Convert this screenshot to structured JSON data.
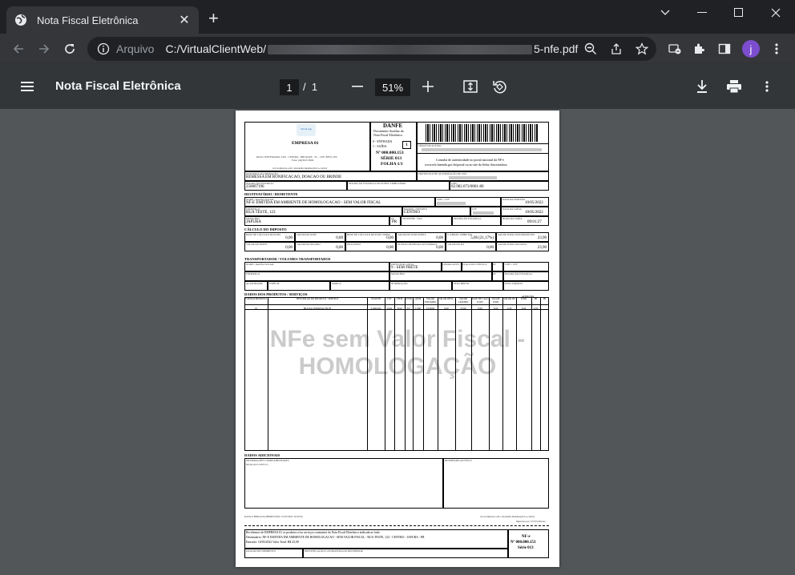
{
  "browser": {
    "tab_title": "Nota Fiscal Eletrônica",
    "tab_close": "✕",
    "new_tab": "+",
    "scheme_label": "Arquivo",
    "url_prefix": "C:/VirtualClientWeb/",
    "url_suffix": "5-nfe.pdf",
    "avatar_letter": "j"
  },
  "pdf_toolbar": {
    "title": "Nota Fiscal Eletrônica",
    "page_current": "1",
    "page_separator": "/",
    "page_total": "1",
    "zoom": "51%"
  },
  "danfe": {
    "company": "EMPRESA 01",
    "address": "RUIO CENTENARIO, 2345 - CENTRO - BRUSQUE - SC - CEP: 88351-500",
    "phone": "Fone: (44)3615-3966",
    "email": "www.empresa.com | alexandre.mendes@tef-o.com.br",
    "danfe_title": "DANFE",
    "danfe_sub1": "Documento Auxiliar da",
    "danfe_sub2": "Nota Fiscal Eletrônica",
    "entrada": "0 - ENTRADA",
    "saida": "1 - SAÍDA",
    "tipo": "1",
    "numero": "Nº 000.000.153",
    "serie": "SÉRIE 013",
    "folha": "FOLHA 1/1",
    "chave_label": "CHAVE DE ACESSO",
    "consulta1": "Consulta de autenticidade no portal nacional da NF-e",
    "consulta2": "www.nfe.fazenda.gov.br/portal ou no site da Sefaz Autorizadora",
    "natureza_label": "NATUREZA DA OPERAÇÃO",
    "natureza": "REMESSA EM BONIFICACAO, DOACAO OU BRINDE",
    "protocolo_label": "PROTOCOLO DE AUTORIZAÇÃO DE USO",
    "ie_label": "INSCRIÇÃO ESTADUAL",
    "ie": "250067196",
    "ie_st_label": "INSCRIÇÃO ESTADUAL DO SUBST. TRIBUTÁRIO",
    "cnpj_label": "CNPJ",
    "cnpj": "02.982.073/0001-80",
    "dest_header": "DESTINATÁRIO / REMETENTE",
    "dest_nome_label": "NOME / RAZÃO SOCIAL",
    "dest_nome": "NF-E EMITIDA EM AMBIENTE DE HOMOLOGACAO - SEM VALOR FISCAL",
    "dest_cnpj_label": "CNPJ / CPF",
    "dest_emissao_label": "DATA DA EMISSÃO",
    "dest_emissao": "10/05/2022",
    "dest_end_label": "ENDEREÇO",
    "dest_end": "RUA TESTE, 123",
    "dest_bairro_label": "BAIRRO / DISTRITO",
    "dest_bairro": "CENTRO",
    "dest_cep_label": "CEP",
    "dest_saida_label": "DATA DA SAÍDA",
    "dest_saida": "10/05/2022",
    "dest_mun_label": "MUNICÍPIO",
    "dest_mun": "JAPURA",
    "dest_uf_label": "UF",
    "dest_uf": "PR",
    "dest_fone_label": "TELEFONE / FAX",
    "dest_ie_label": "INSCRIÇÃO ESTADUAL",
    "dest_hora_label": "HORA DA SAÍDA",
    "dest_hora": "09:01:27",
    "imp_header": "CÁLCULO DO IMPOSTO",
    "imp_row1": [
      {
        "label": "BASE DE CÁLCULO DO ICMS",
        "value": "0,00"
      },
      {
        "label": "VALOR DO ICMS",
        "value": "0,00"
      },
      {
        "label": "BASE DE CÁLCULO DO ICMS SUBST.",
        "value": "0,00"
      },
      {
        "label": "VALOR DO ICMS SUBST.",
        "value": "0,00"
      },
      {
        "label": "V. APROX. TRIBUTOS",
        "value": "5,06 (21,17%)"
      },
      {
        "label": "VALOR TOTAL DOS PRODUTOS",
        "value": "23,90"
      }
    ],
    "imp_row2": [
      {
        "label": "VALOR DO FRETE",
        "value": "0,00"
      },
      {
        "label": "VALOR DO SEGURO",
        "value": "0,00"
      },
      {
        "label": "DESCONTO",
        "value": "0,00"
      },
      {
        "label": "OUTRAS DESPESAS ACESSÓRIAS",
        "value": "0,00"
      },
      {
        "label": "VALOR DO IPI",
        "value": "0,00"
      },
      {
        "label": "VALOR TOTAL DA NOTA",
        "value": "23,90"
      }
    ],
    "transp_header": "TRANSPORTADOR / VOLUMES TRANSPORTADOS",
    "transp_nome_label": "NOME / RAZÃO SOCIAL",
    "frete_label": "FRETE POR CONTA",
    "frete": "9 - SEM FRETE",
    "antt_label": "CÓDIGO ANTT",
    "placa_label": "PLACA DO VEÍCULO",
    "uf_label": "UF",
    "cnpjcpf_label": "CNPJ / CPF",
    "endereco_label": "ENDEREÇO",
    "municipio_label": "MUNICÍPIO",
    "ie2_label": "INSCRIÇÃO ESTADUAL",
    "vol_labels": [
      "QUANTIDADE",
      "ESPÉCIE",
      "MARCA",
      "NUMERAÇÃO",
      "PESO BRUTO",
      "PESO LÍQUIDO"
    ],
    "prod_header": "DADOS DOS PRODUTOS / SERVIÇOS",
    "prod_cols": [
      "CÓDIGO PRODUTO",
      "DESCRIÇÃO DO PRODUTO / SERVIÇO",
      "NCM/SH",
      "CST",
      "CFOP",
      "UNID",
      "QTDE",
      "VALOR UNITÁRIO",
      "VALOR DESC.",
      "VALOR LÍQUIDO",
      "BASE DE CÁLC ICMS",
      "VALOR ICMS",
      "VALOR IPI",
      "ICMS",
      "IPI"
    ],
    "prod_row": [
      "10",
      "BLUSA CHATINA TECH",
      "61091000",
      "0102",
      "5910",
      "PC",
      "1,000",
      "23,9000",
      "0,00",
      "23,90",
      "0,00",
      "0,00",
      "0,00",
      "0,00",
      "0,00"
    ],
    "aliq_label": "ALÍQUOTA",
    "watermark1": "NFe sem Valor Fiscal -",
    "watermark2": "HOMOLOGAÇÃO",
    "adic_header": "DADOS ADICIONAIS",
    "info_label": "INFORMAÇÕES COMPLEMENTARES",
    "info_value": "DOACAO CUETC2...",
    "fisco_label": "RESERVADO AO FISCO",
    "impressao": "DATA E HORA DA IMPRESSÃO: 10/05/2022 10:56:56",
    "rodape_site": "www.empresa.com | alexandre.mendes@tef-o.com.br",
    "rodape_sw": "Impresso por: VCP Software",
    "receb_text1": "Recebemos de EMPRESA 01 os produtos e/ou serviços constantes da Nota Fiscal Eletrônica indicada ao lado.",
    "receb_text2": "Destinatário: NF-E EMITIDA EM AMBIENTE DE HOMOLOGACAO - SEM VALOR FISCAL - RUA TESTE, 123 - CENTRO - JAPURA - PR",
    "receb_text3": "Emissão: 10/05/2022  Valor Total: R$ 23,90",
    "receb_data_label": "DATA DO RECEBIMENTO",
    "receb_ident_label": "IDENTIFICAÇÃO E ASSINATURA DO RECEBEDOR",
    "receb_nfe": "NF-e",
    "receb_num": "Nº 000.000.153",
    "receb_serie": "Série 013"
  },
  "colors": {
    "chrome_dark": "#202124",
    "chrome_toolbar": "#35363a",
    "pdf_toolbar": "#323639",
    "viewer_bg": "#525659",
    "avatar": "#7c4dce"
  }
}
